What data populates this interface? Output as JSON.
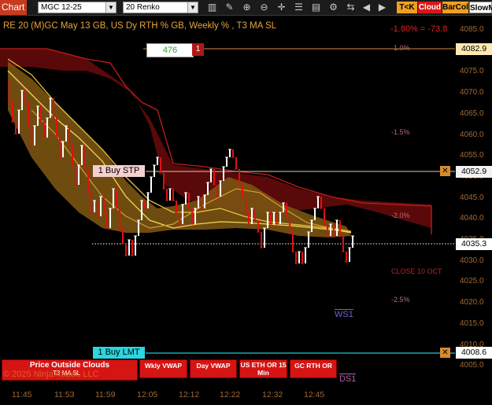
{
  "toolbar": {
    "chart_tab": "Chart",
    "instrument": "MGC 12-25",
    "bar_type": "20 Renko",
    "tkk": "T<K",
    "cloud": "Cloud",
    "barcol": "BarCol",
    "slowm": "SlowM",
    "icons": [
      "bar-chart-icon",
      "drawing-tools-icon",
      "zoom-in-icon",
      "zoom-out-icon",
      "crosshair-icon",
      "properties-icon",
      "data-box-icon",
      "strategy-icon",
      "chart-trader-icon",
      "prev-icon",
      "next-icon"
    ]
  },
  "chart": {
    "title": "RE 20  (M)GC May 13 GB, US Dy RTH % GB, Weekly % , T3 MA SL",
    "pct_change": "-1.80% = -73.8",
    "counter_value": "476",
    "counter_qty": "1",
    "order_buy_stp": "1 Buy STP",
    "order_buy_lmt": "1 Buy LMT",
    "pct_levels": [
      "1.0%",
      "-1.5%",
      "-2.0%",
      "-2.5%"
    ],
    "close_label": "CLOSE 10 OCT",
    "ws1": "WS1",
    "ds1": "DS1",
    "copyright": "© 2025 NinjaTrader, LLC",
    "panel_left_title": "Price Outside Clouds",
    "panel_left_sub": "T3 MA SL",
    "btn_wkly_vwap": "Wkly VWAP",
    "btn_day_vwap": "Day VWAP",
    "btn_us_eth": "US ETH OR 15 Min",
    "btn_gc_rth": "GC RTH OR",
    "colors": {
      "up_bar": "#ffffff",
      "down_bar": "#e01010",
      "cloud_top": "#6b0a0a",
      "cloud_mid": "#9a6a12",
      "ma_line": "#e8c23a"
    }
  },
  "yaxis": {
    "ticks": [
      "4085.0",
      "4080.0",
      "4075.0",
      "4070.0",
      "4065.0",
      "4060.0",
      "4055.0",
      "4050.0",
      "4045.0",
      "4040.0",
      "4035.0",
      "4030.0",
      "4025.0",
      "4020.0",
      "4015.0",
      "4010.0",
      "4005.0"
    ],
    "price_level_1": "4082.9",
    "price_level_2": "4052.9",
    "current_price": "4035.3",
    "price_level_3": "4008.6"
  },
  "xaxis": {
    "labels": [
      "11:45",
      "11:53",
      "11:59",
      "12:05",
      "12:12",
      "12:22",
      "12:32",
      "12:45"
    ]
  }
}
